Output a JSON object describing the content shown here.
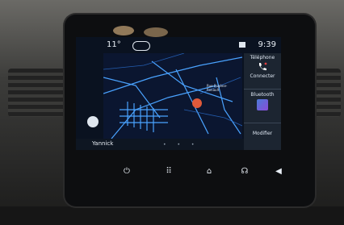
{
  "status": {
    "temperature": "11°",
    "time": "9:39"
  },
  "sidebar": {
    "phone_label": "Téléphone",
    "connect_label": "Connecter",
    "bluetooth_label": "Bluetooth",
    "modify_label": "Modifier"
  },
  "map": {
    "location_label": "Rue Eugène-Renault"
  },
  "footer": {
    "user_name": "Yannick",
    "page_dots": "• • •"
  },
  "hardware_buttons": [
    {
      "icon": "power-icon",
      "glyph": "⏻"
    },
    {
      "icon": "apps-grid-icon",
      "glyph": "⠿"
    },
    {
      "icon": "home-icon",
      "glyph": "⌂"
    },
    {
      "icon": "voice-icon",
      "glyph": "☊"
    },
    {
      "icon": "volume-icon",
      "glyph": "◀"
    }
  ]
}
